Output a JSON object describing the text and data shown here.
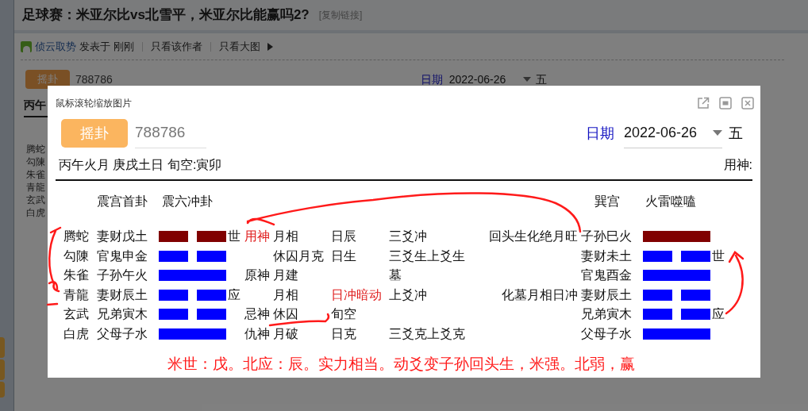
{
  "page": {
    "title": "足球赛：米亚尔比vs北雪平，米亚尔比能赢吗2?",
    "copy_link": "[复制链接]",
    "author": "侦云取势",
    "posted": "发表于 刚刚",
    "links": [
      "只看该作者",
      "只看大图"
    ]
  },
  "background_app": {
    "button": "摇卦",
    "number": "788786",
    "date_label": "日期",
    "date": "2022-06-26",
    "month": "五",
    "ganzhi": "丙午",
    "gods": [
      "腾蛇",
      "勾陳",
      "朱雀",
      "青龍",
      "玄武",
      "白虎"
    ]
  },
  "viewer": {
    "title": "鼠标滚轮缩放图片",
    "app": {
      "button": "摇卦",
      "number": "788786",
      "date_label": "日期",
      "date": "2022-06-26",
      "month": "五",
      "ganzhi": "丙午火月 庚戌土日 旬空:寅卯",
      "yongshen": "用神:",
      "main_palace": "震宫首卦",
      "main_name": "震六冲卦",
      "changed_palace": "巽宫",
      "changed_name": "火雷噬嗑",
      "rows": [
        {
          "god": "腾蛇",
          "relation": "妻财戊土",
          "broken": true,
          "moving": true,
          "marker": "世",
          "role": "用神",
          "role_emphasized": true,
          "month": "月相",
          "day": "日辰",
          "day_emphasized": false,
          "sanyao": "三爻冲",
          "change_note": "回头生化绝月旺",
          "changed_relation": "子孙巳火",
          "changed_broken": false,
          "changed_moving": true
        },
        {
          "god": "勾陳",
          "relation": "官鬼申金",
          "broken": true,
          "moving": false,
          "month": "休囚月克",
          "day": "日生",
          "day_emphasized": false,
          "sanyao": "三爻生上爻生",
          "changed_relation": "妻财未土",
          "changed_broken": true,
          "changed_moving": false,
          "changed_marker": "世"
        },
        {
          "god": "朱雀",
          "relation": "子孙午火",
          "broken": false,
          "moving": false,
          "role": "原神",
          "role_emphasized": false,
          "month": "月建",
          "sanyao": "墓",
          "changed_relation": "官鬼酉金",
          "changed_broken": false,
          "changed_moving": false
        },
        {
          "god": "青龍",
          "relation": "妻财辰土",
          "broken": true,
          "moving": false,
          "marker": "应",
          "month": "月相",
          "day": "日冲暗动",
          "day_emphasized": true,
          "sanyao": "上爻冲",
          "change_note": "化墓月相日冲",
          "changed_relation": "妻财辰土",
          "changed_broken": true,
          "changed_moving": false
        },
        {
          "god": "玄武",
          "relation": "兄弟寅木",
          "broken": true,
          "moving": false,
          "role": "忌神",
          "role_emphasized": false,
          "month": "休囚",
          "day": "旬空",
          "day_emphasized": false,
          "changed_relation": "兄弟寅木",
          "changed_broken": true,
          "changed_moving": false,
          "changed_marker": "应"
        },
        {
          "god": "白虎",
          "relation": "父母子水",
          "broken": false,
          "moving": false,
          "role": "仇神",
          "role_emphasized": false,
          "month": "月破",
          "day": "日克",
          "day_emphasized": false,
          "sanyao": "三爻克上爻克",
          "changed_relation": "父母子水",
          "changed_broken": false,
          "changed_moving": false
        }
      ],
      "note": "米世：戊。北应：辰。实力相当。动爻变子孙回头生，米强。北弱，赢"
    }
  }
}
